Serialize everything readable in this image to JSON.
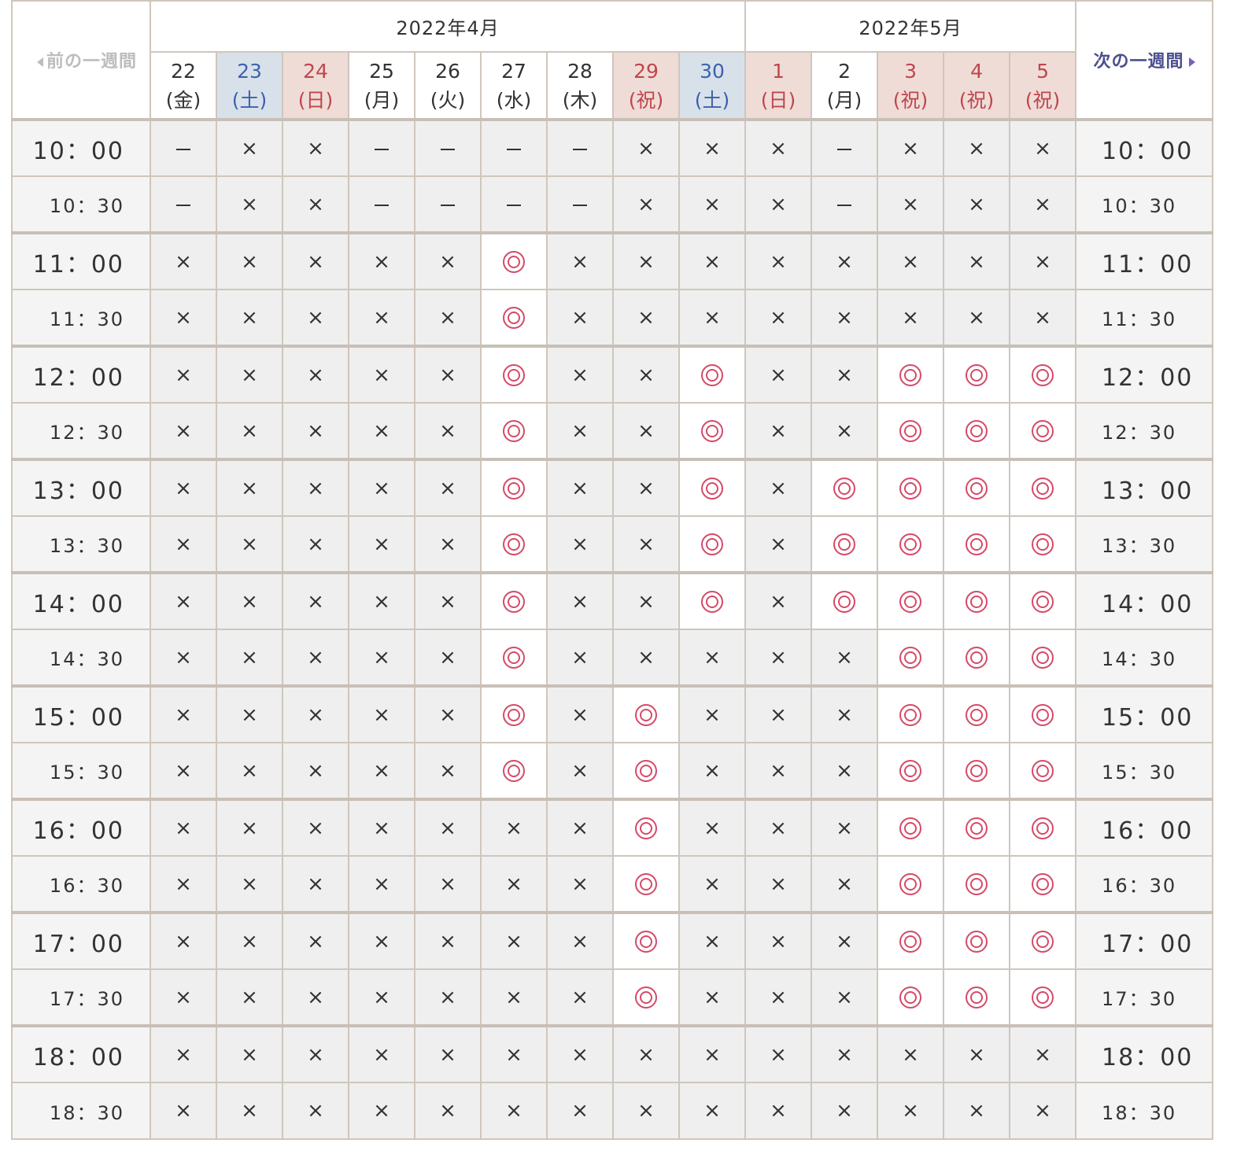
{
  "nav": {
    "prev_label": "前の一週間",
    "next_label": "次の一週間"
  },
  "months": [
    {
      "label": "2022年4月",
      "span": 9
    },
    {
      "label": "2022年5月",
      "span": 5
    }
  ],
  "days": [
    {
      "num": "22",
      "weekday": "(金)",
      "type": "plain"
    },
    {
      "num": "23",
      "weekday": "(土)",
      "type": "sat"
    },
    {
      "num": "24",
      "weekday": "(日)",
      "type": "hol"
    },
    {
      "num": "25",
      "weekday": "(月)",
      "type": "plain"
    },
    {
      "num": "26",
      "weekday": "(火)",
      "type": "plain"
    },
    {
      "num": "27",
      "weekday": "(水)",
      "type": "plain"
    },
    {
      "num": "28",
      "weekday": "(木)",
      "type": "plain"
    },
    {
      "num": "29",
      "weekday": "(祝)",
      "type": "hol"
    },
    {
      "num": "30",
      "weekday": "(土)",
      "type": "sat"
    },
    {
      "num": "1",
      "weekday": "(日)",
      "type": "hol"
    },
    {
      "num": "2",
      "weekday": "(月)",
      "type": "plain"
    },
    {
      "num": "3",
      "weekday": "(祝)",
      "type": "hol"
    },
    {
      "num": "4",
      "weekday": "(祝)",
      "type": "hol"
    },
    {
      "num": "5",
      "weekday": "(祝)",
      "type": "hol"
    }
  ],
  "legend": {
    "available": "◎",
    "full": "×",
    "closed": "－"
  },
  "rows": [
    {
      "time": "10：00",
      "hour": true,
      "slots": "-xx----xxx-xxx"
    },
    {
      "time": "10：30",
      "hour": false,
      "slots": "-xx----xxx-xxx"
    },
    {
      "time": "11：00",
      "hour": true,
      "slots": "xxxxxoxxxxxxxx"
    },
    {
      "time": "11：30",
      "hour": false,
      "slots": "xxxxxoxxxxxxxx"
    },
    {
      "time": "12：00",
      "hour": true,
      "slots": "xxxxxoxxoxxooo"
    },
    {
      "time": "12：30",
      "hour": false,
      "slots": "xxxxxoxxoxxooo"
    },
    {
      "time": "13：00",
      "hour": true,
      "slots": "xxxxxoxxoxoooo"
    },
    {
      "time": "13：30",
      "hour": false,
      "slots": "xxxxxoxxoxoooo"
    },
    {
      "time": "14：00",
      "hour": true,
      "slots": "xxxxxoxxoxoooo"
    },
    {
      "time": "14：30",
      "hour": false,
      "slots": "xxxxxoxxxxxooo"
    },
    {
      "time": "15：00",
      "hour": true,
      "slots": "xxxxxoxoxxxooo"
    },
    {
      "time": "15：30",
      "hour": false,
      "slots": "xxxxxoxoxxxooo"
    },
    {
      "time": "16：00",
      "hour": true,
      "slots": "xxxxxxxoxxxooo"
    },
    {
      "time": "16：30",
      "hour": false,
      "slots": "xxxxxxxoxxxooo"
    },
    {
      "time": "17：00",
      "hour": true,
      "slots": "xxxxxxxoxxxooo"
    },
    {
      "time": "17：30",
      "hour": false,
      "slots": "xxxxxxxoxxxooo"
    },
    {
      "time": "18：00",
      "hour": true,
      "slots": "xxxxxxxxxxxxxx"
    },
    {
      "time": "18：30",
      "hour": false,
      "slots": "xxxxxxxxxxxxxx"
    }
  ],
  "colors": {
    "available_mark": "#d54a68",
    "saturday_bg": "#d8e1ea",
    "saturday_text": "#3c62ad",
    "holiday_bg": "#efdcd7",
    "holiday_text": "#c0464d",
    "next_link": "#4b4f8e",
    "prev_link_disabled": "#bdbdbd"
  }
}
